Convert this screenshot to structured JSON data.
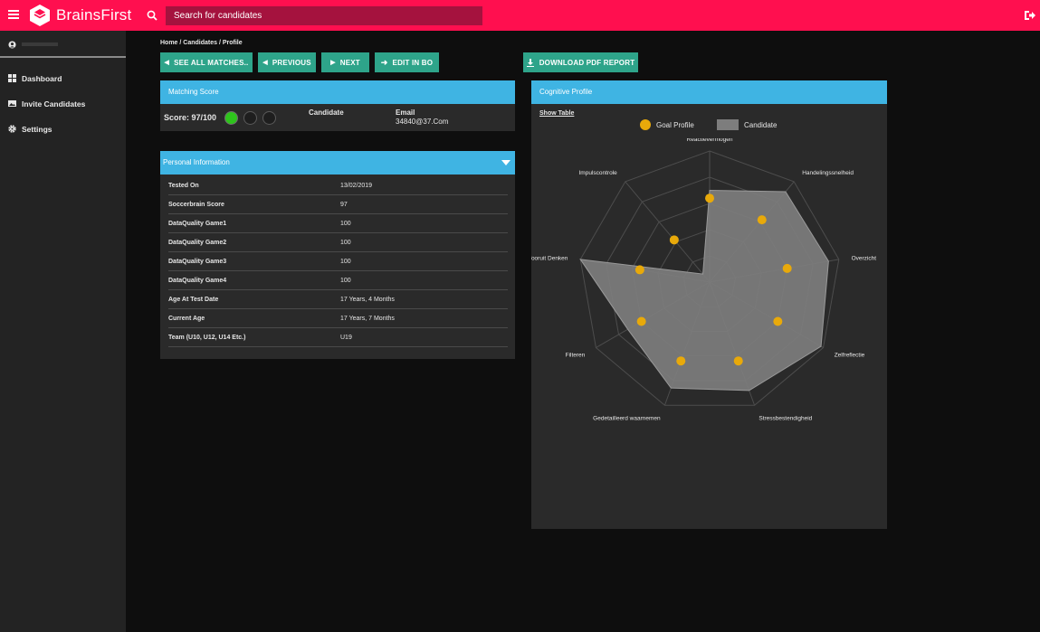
{
  "header": {
    "logo_text": "BrainsFirst",
    "search_placeholder": "Search for candidates",
    "accent_color": "#ff0f4f"
  },
  "sidebar": {
    "items": [
      {
        "label": "Dashboard",
        "icon": "dashboard-icon"
      },
      {
        "label": "Invite Candidates",
        "icon": "image-icon"
      },
      {
        "label": "Settings",
        "icon": "gear-icon"
      }
    ]
  },
  "breadcrumb": "Home / Candidates / Profile",
  "toolbar": {
    "see_all_label": "SEE ALL MATCHES..",
    "previous_label": "PREVIOUS",
    "next_label": "NEXT",
    "edit_label": "EDIT IN BO",
    "download_label": "DOWNLOAD PDF REPORT",
    "button_color": "#2ea48a"
  },
  "matching": {
    "title": "Matching Score",
    "score_label": "Score: 97/100",
    "indicators": [
      true,
      false,
      false
    ],
    "candidate_label": "Candidate",
    "email_label": "Email",
    "email_value": "34840@37.Com"
  },
  "personal": {
    "title": "Personal Information",
    "rows": [
      {
        "key": "Tested On",
        "value": "13/02/2019"
      },
      {
        "key": "Soccerbrain Score",
        "value": "97"
      },
      {
        "key": "DataQuality Game1",
        "value": "100"
      },
      {
        "key": "DataQuality Game2",
        "value": "100"
      },
      {
        "key": "DataQuality Game3",
        "value": "100"
      },
      {
        "key": "DataQuality Game4",
        "value": "100"
      },
      {
        "key": "Age At Test Date",
        "value": "17 Years, 4 Months"
      },
      {
        "key": "Current Age",
        "value": "17 Years, 7 Months"
      },
      {
        "key": "Team (U10, U12, U14 Etc.)",
        "value": "U19"
      }
    ]
  },
  "cognitive": {
    "title": "Cognitive Profile",
    "show_table": "Show Table",
    "legend_goal": "Goal Profile",
    "legend_candidate": "Candidate",
    "goal_color": "#e8a90a",
    "candidate_color": "#7d7d7d"
  },
  "chart_data": {
    "type": "radar",
    "categories": [
      "Reactievermogen",
      "Handelingssnelheid",
      "Overzicht",
      "Zelfreflectie",
      "Stressbestendigheid",
      "Gedetailleerd waarnemen",
      "Filteren",
      "Vooruit Denken",
      "Impulscontrole"
    ],
    "rlim": [
      0,
      5
    ],
    "series": [
      {
        "name": "Goal Profile",
        "style": "points",
        "values": [
          3.2,
          3.1,
          3.0,
          3.0,
          3.2,
          3.2,
          3.0,
          2.7,
          2.1
        ]
      },
      {
        "name": "Candidate",
        "style": "area",
        "values": [
          3.5,
          4.5,
          4.6,
          4.9,
          4.4,
          4.3,
          3.6,
          5.0,
          0.4
        ]
      }
    ]
  }
}
